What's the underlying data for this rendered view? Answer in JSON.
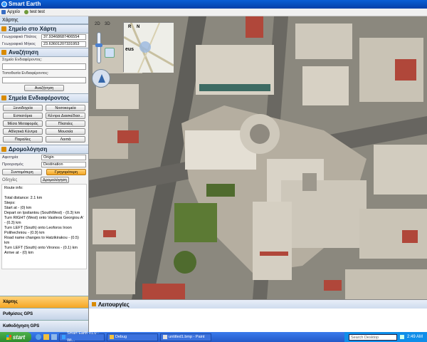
{
  "app": {
    "title": "Smart Earth"
  },
  "menu": {
    "items": [
      "Αρχείο",
      "test test"
    ]
  },
  "left_panel": {
    "title": "Χάρτης"
  },
  "point_on_map": {
    "title": "Σημείο στο Χάρτη",
    "lat_label": "Γεωγραφικό Πλάτος",
    "lat_value": "37.93468687406554",
    "lon_label": "Γεωγραφικό Μήκος",
    "lon_value": "23.63601207331953"
  },
  "search": {
    "title": "Αναζήτηση",
    "point_label": "Σημείο Ενδιαφέροντος:",
    "location_label": "Τοποθεσία Ενδιαφέροντος:",
    "button": "Αναζήτηση"
  },
  "poi": {
    "title": "Σημεία Ενδιαφέροντος",
    "buttons": [
      "Ξενοδοχεία",
      "Νοσοκομεία",
      "Εστιατόρια",
      "Κέντρα Διασκέδασ...",
      "Μέσα Μεταφοράς",
      "Πλατείες",
      "Αθλητικά Κέντρα",
      "Μουσεία",
      "Παραλίες",
      "Λοιπά"
    ]
  },
  "routing": {
    "title": "Δρομολόγηση",
    "start_label": "Αφετηρία",
    "start_value": "Origin",
    "dest_label": "Προορισμός",
    "dest_value": "Destination",
    "shortest_button": "Συντομότερη",
    "fastest_button": "Γρηγορότερη",
    "route_button": "Δρομολόγηση",
    "directions_label": "Οδηγίες",
    "info": "Route info:\n\nTotal distance: 2.1 km\nSteps:\nStart at - (0) km\nDepart   on Ipsilantou (SouthWest) - (0.3) km\nTurn RIGHT (West) onto Vasileos Georgiou A' - (0.3) km\nTurn LEFT (South) onto Leoforos Iroon Polihechniou - (0.9) km\nRoad name changes to Hatzikirakou - (0.5) km\nTurn LEFT (South) onto Vironos - (0.1) km\nArrive at  - (0) km"
  },
  "bottom_tabs": [
    "Χάρτης",
    "Ρυθμίσεις GPS",
    "Καθοδήγηση GPS"
  ],
  "functions_panel": {
    "title": "Λειτουργίες"
  },
  "map": {
    "mode_2d": "2D",
    "mode_3d": "3D",
    "rotate_label": "R",
    "north_label": "N",
    "eus_label": "eus",
    "colors": {
      "roof_light": "#d7d1c4",
      "roof_red": "#b0473a",
      "road": "#5f5e59",
      "vegetation": "#4f6b2e"
    }
  },
  "taskbar": {
    "start": "start",
    "tasks": [
      "Smart Earth v1.0 - Wi...",
      "Debug",
      "untitled1.bmp - Paint"
    ],
    "search_placeholder": "Search Desktop",
    "time": "2:49 AM"
  }
}
